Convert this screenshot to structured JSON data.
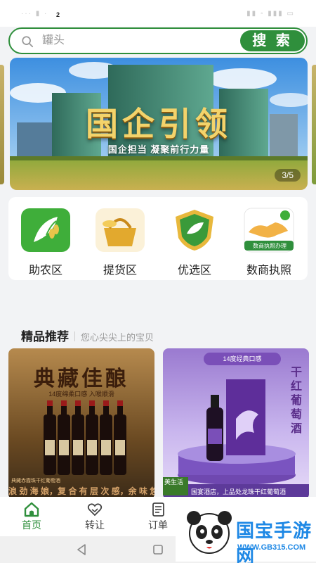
{
  "status_bar": {
    "left_text": "··· ▮ ·",
    "notification_count": "2",
    "right_text": "▮▮ ◦ ▮▮▮ ▭"
  },
  "search": {
    "placeholder": "罐头",
    "button_label": "搜 索"
  },
  "banner": {
    "title": "国企引领",
    "subtitle": "国企担当 凝聚前行力量",
    "counter": "3/5"
  },
  "quick_menu": [
    {
      "label": "助农区",
      "icon": "rice-leaf-icon"
    },
    {
      "label": "提货区",
      "icon": "gold-basket-icon"
    },
    {
      "label": "优选区",
      "icon": "green-shield-icon"
    },
    {
      "label": "数商执照",
      "icon": "handshake-license-icon",
      "badge": "数商执照办理"
    }
  ],
  "section": {
    "title": "精品推荐",
    "subtitle": "您心尖尖上的宝贝"
  },
  "products": [
    {
      "title": "典藏佳酿",
      "subtitle": "14度绵柔口感 入喉顺滑",
      "footer": "浪 劲 海 娘，复 合 有 层 次 感，余 味 悠 长 持 久",
      "small_text": "典藏赤霞珠干红葡萄酒"
    },
    {
      "tag": "14度经典口感",
      "vertical_text": "干红葡萄酒",
      "footer": "国宴酒店，上品处龙珠干红葡萄酒",
      "badge": "美生活"
    }
  ],
  "bottom_nav": [
    {
      "label": "首页",
      "icon": "home-icon",
      "active": true
    },
    {
      "label": "转让",
      "icon": "heart-hand-icon",
      "active": false
    },
    {
      "label": "订单",
      "icon": "order-list-icon",
      "active": false
    },
    {
      "label": "",
      "icon": "play-icon",
      "active": false
    },
    {
      "label": "",
      "icon": "user-icon",
      "active": false
    }
  ],
  "watermark": {
    "title": "国宝手游网",
    "url": "WWW.GB315.COM"
  },
  "colors": {
    "brand_green": "#2f8f3c",
    "watermark_blue": "#1e88e5"
  }
}
